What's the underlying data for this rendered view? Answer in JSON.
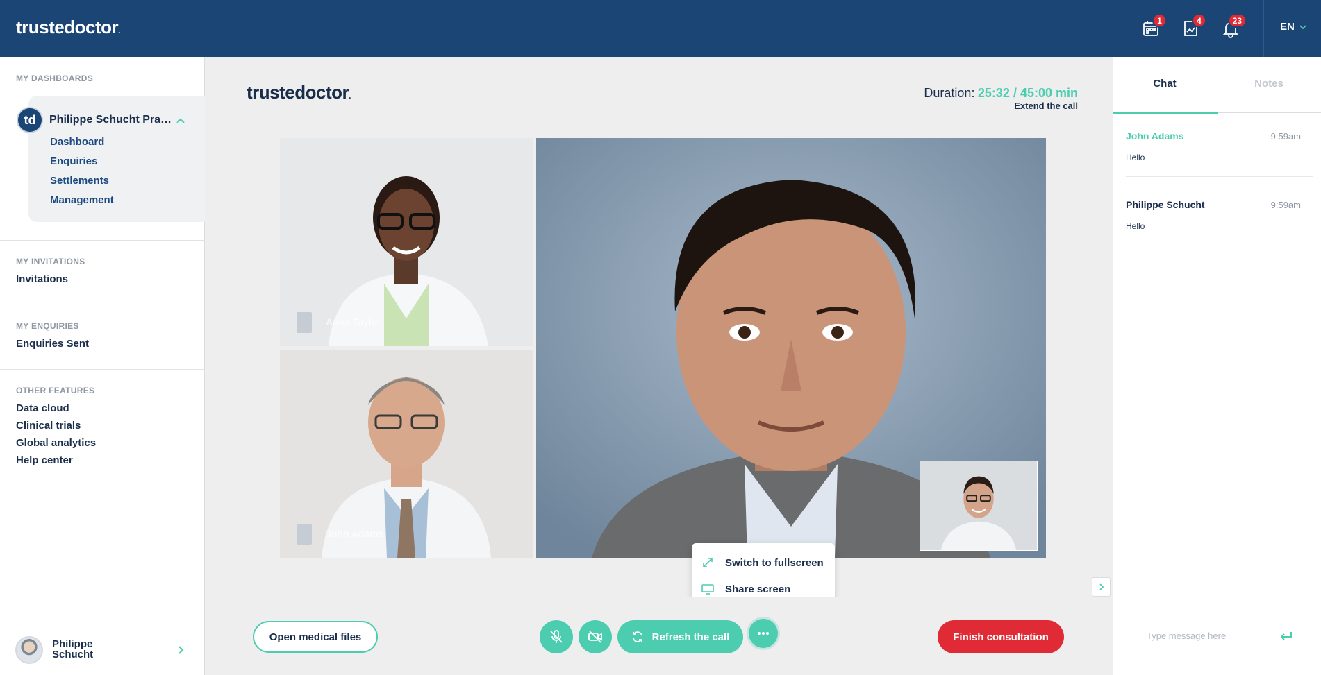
{
  "app": {
    "logo": "trustedoctor",
    "language": "EN"
  },
  "topbar": {
    "icons": [
      {
        "name": "calendar-icon",
        "badge": "1"
      },
      {
        "name": "chart-icon",
        "badge": "4"
      },
      {
        "name": "bell-icon",
        "badge": "23"
      }
    ]
  },
  "sidebar": {
    "dashboards_label": "MY DASHBOARDS",
    "practice_avatar": "td",
    "practice_name": "Philippe Schucht Practice",
    "practice_links": [
      "Dashboard",
      "Enquiries",
      "Settlements",
      "Management"
    ],
    "invitations_label": "MY INVITATIONS",
    "invitations_link": "Invitations",
    "enquiries_label": "MY ENQUIRIES",
    "enquiries_link": "Enquiries Sent",
    "features_label": "OTHER FEATURES",
    "features_links": [
      "Data cloud",
      "Clinical trials",
      "Global analytics",
      "Help center"
    ],
    "user_name": "Philippe Schucht"
  },
  "call": {
    "duration_label": "Duration:",
    "duration_value": "25:32 / 45:00 min",
    "extend_label": "Extend the call",
    "participants": [
      {
        "name": "Anna Taylor"
      },
      {
        "name": "John Adams"
      }
    ]
  },
  "popover": {
    "fullscreen": "Switch to fullscreen",
    "share": "Share screen"
  },
  "controls": {
    "open_files": "Open medical files",
    "refresh": "Refresh the call",
    "finish": "Finish consultation"
  },
  "chat": {
    "tab_chat": "Chat",
    "tab_notes": "Notes",
    "messages": [
      {
        "name": "John Adams",
        "time": "9:59am",
        "text": "Hello",
        "color": "#4ccdb0"
      },
      {
        "name": "Philippe Schucht",
        "time": "9:59am",
        "text": "Hello",
        "color": "#1a2e4c"
      }
    ],
    "placeholder": "Type message here"
  },
  "colors": {
    "brand": "#1b4574",
    "accent": "#4ccdb0",
    "danger": "#e02b36"
  }
}
